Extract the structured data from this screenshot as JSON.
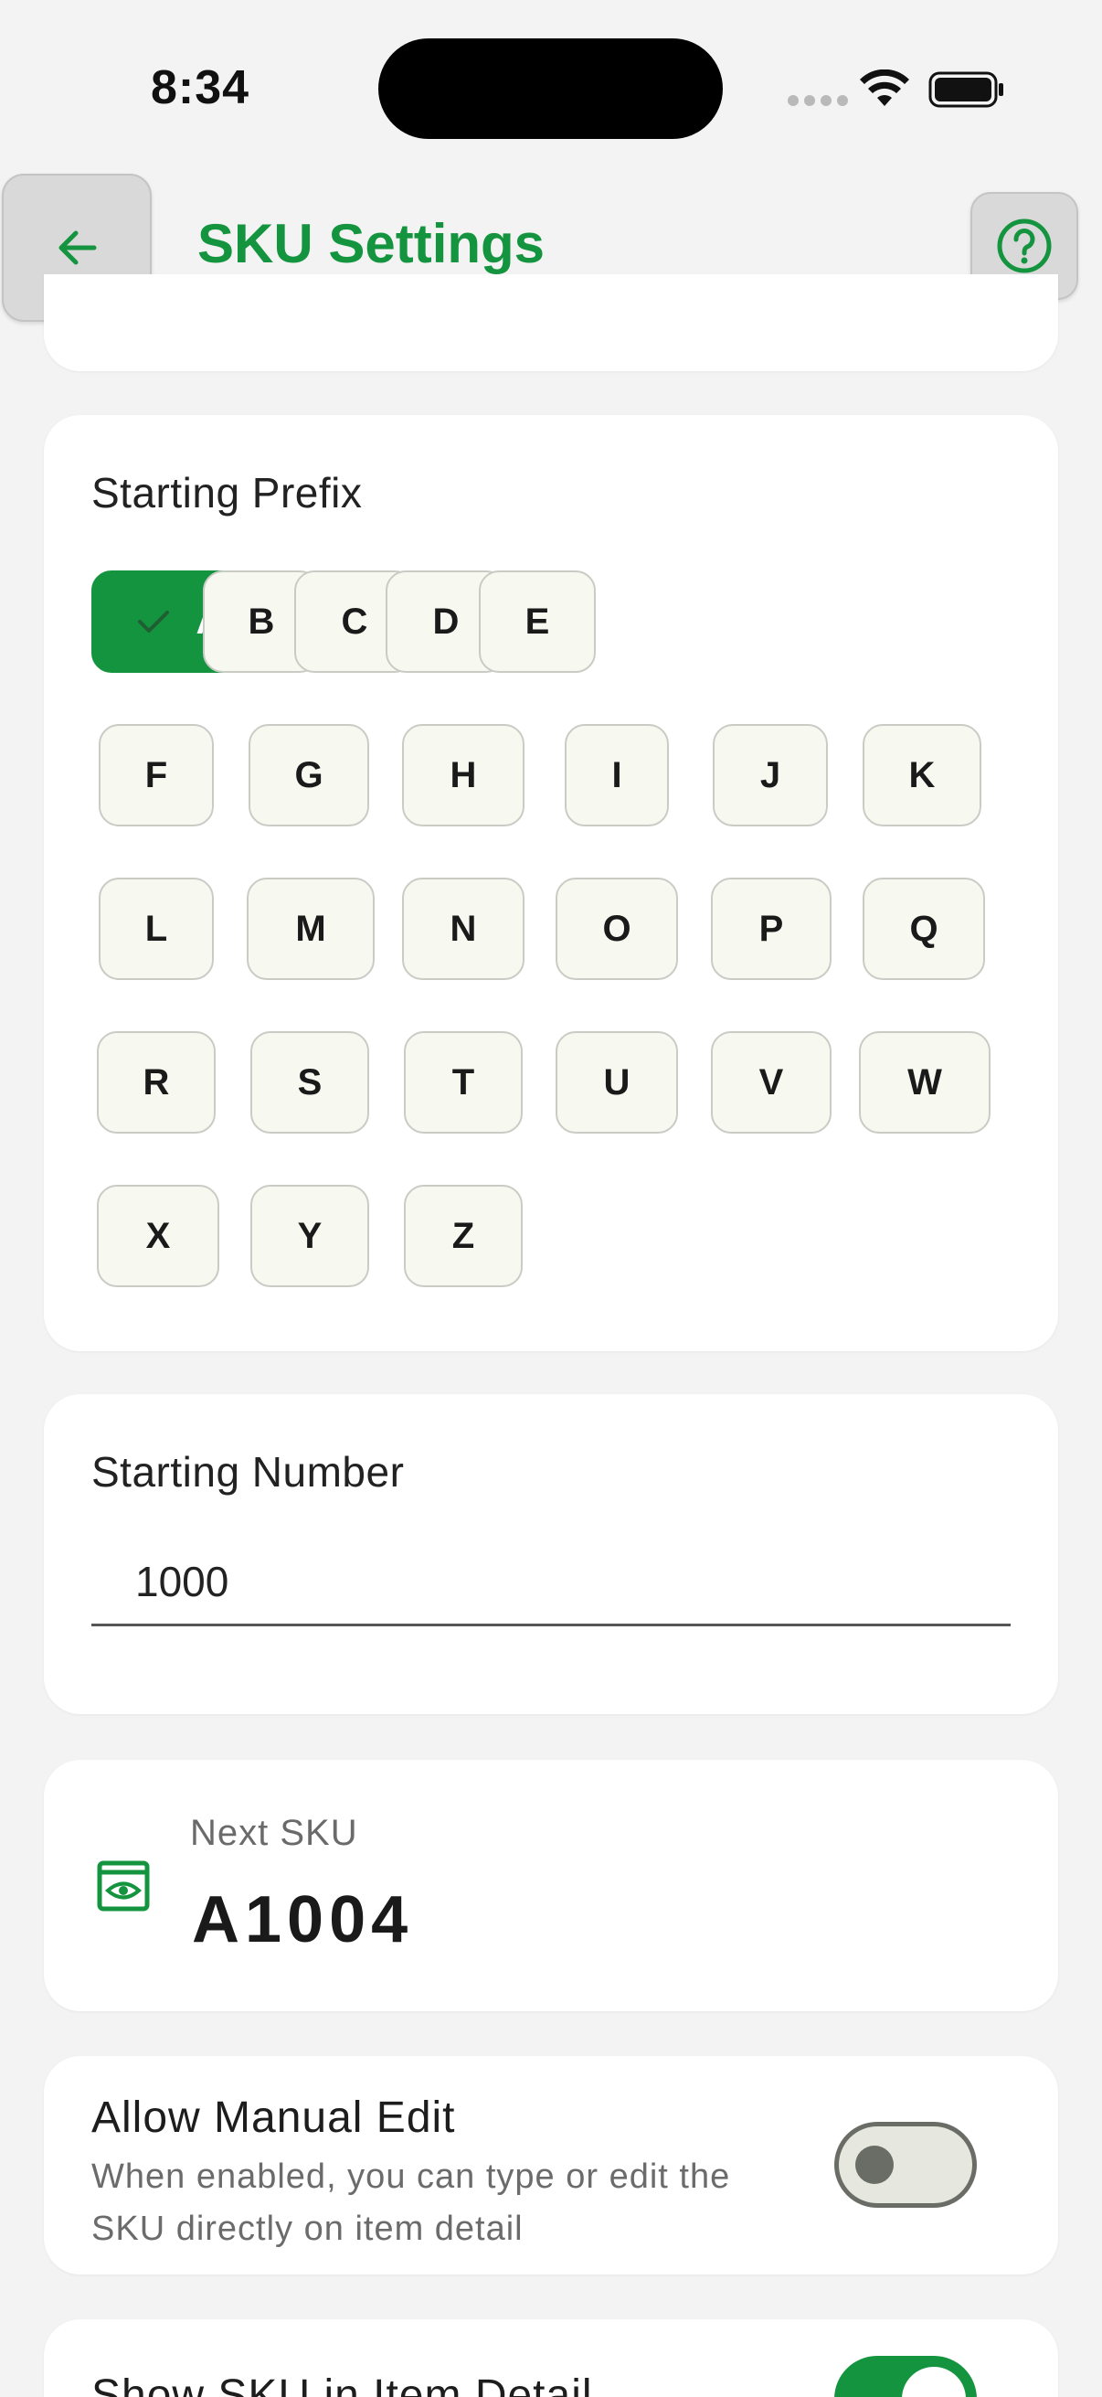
{
  "status_bar": {
    "time": "8:34"
  },
  "header": {
    "title": "SKU Settings"
  },
  "starting_prefix": {
    "label": "Starting Prefix",
    "selected": "A",
    "rows": [
      [
        "A",
        "B",
        "C",
        "D",
        "E"
      ],
      [
        "F",
        "G",
        "H",
        "I",
        "J",
        "K"
      ],
      [
        "L",
        "M",
        "N",
        "O",
        "P",
        "Q"
      ],
      [
        "R",
        "S",
        "T",
        "U",
        "V",
        "W"
      ],
      [
        "X",
        "Y",
        "Z"
      ]
    ]
  },
  "starting_number": {
    "label": "Starting Number",
    "value": "1000"
  },
  "next_sku": {
    "label": "Next SKU",
    "value": "A1004",
    "icon": "eye-icon"
  },
  "allow_manual_edit": {
    "title": "Allow Manual Edit",
    "description": "When enabled, you can type or edit the SKU directly on item detail",
    "enabled": false
  },
  "show_sku": {
    "title": "Show SKU in Item Detail",
    "enabled": true
  },
  "colors": {
    "accent": "#15943f",
    "chip_bg": "#f7f9f1",
    "background": "#f3f3f3"
  }
}
